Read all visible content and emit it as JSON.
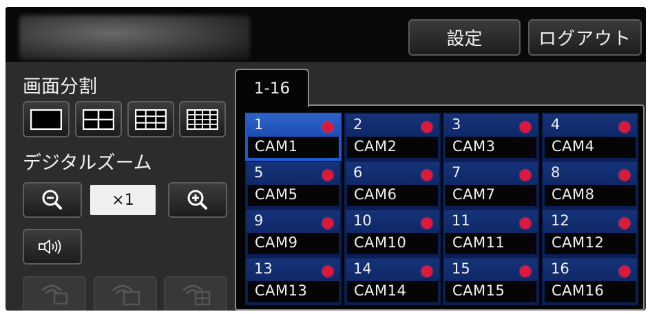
{
  "header": {
    "settings_label": "設定",
    "logout_label": "ログアウト"
  },
  "left_panel": {
    "split_label": "画面分割",
    "zoom_label": "デジタルズーム",
    "zoom_value": "×1",
    "split_options": [
      "1-screen",
      "4-screen",
      "9-screen",
      "16-screen"
    ]
  },
  "tabs": [
    {
      "label": "1-16",
      "active": true
    }
  ],
  "cameras": [
    {
      "num": "1",
      "name": "CAM1",
      "selected": true
    },
    {
      "num": "2",
      "name": "CAM2"
    },
    {
      "num": "3",
      "name": "CAM3"
    },
    {
      "num": "4",
      "name": "CAM4"
    },
    {
      "num": "5",
      "name": "CAM5"
    },
    {
      "num": "6",
      "name": "CAM6"
    },
    {
      "num": "7",
      "name": "CAM7"
    },
    {
      "num": "8",
      "name": "CAM8"
    },
    {
      "num": "9",
      "name": "CAM9"
    },
    {
      "num": "10",
      "name": "CAM10"
    },
    {
      "num": "11",
      "name": "CAM11"
    },
    {
      "num": "12",
      "name": "CAM12"
    },
    {
      "num": "13",
      "name": "CAM13"
    },
    {
      "num": "14",
      "name": "CAM14"
    },
    {
      "num": "15",
      "name": "CAM15"
    },
    {
      "num": "16",
      "name": "CAM16"
    }
  ],
  "colors": {
    "background": "#2c2c2c",
    "cell_band": "#163379",
    "selected_band": "#2e63c7",
    "recording_dot": "#e0173a"
  }
}
